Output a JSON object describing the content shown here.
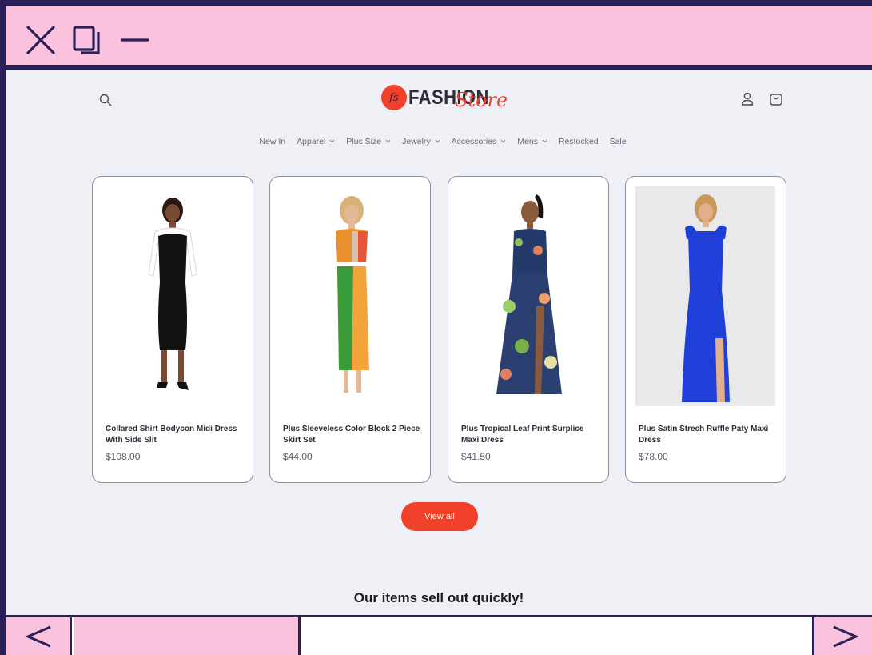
{
  "window": {
    "controls": [
      "close-icon",
      "restore-icon",
      "minimize-icon"
    ],
    "accent": "#fbc2dd",
    "frame_color": "#2a1f56"
  },
  "store": {
    "logo_mark": "fs",
    "logo_main": "FASHION",
    "logo_script": "Store",
    "brand_color": "#f0412b",
    "nav": [
      {
        "label": "New In",
        "dropdown": false
      },
      {
        "label": "Apparel",
        "dropdown": true
      },
      {
        "label": "Plus Size",
        "dropdown": true
      },
      {
        "label": "Jewelry",
        "dropdown": true
      },
      {
        "label": "Accessories",
        "dropdown": true
      },
      {
        "label": "Mens",
        "dropdown": true
      },
      {
        "label": "Restocked",
        "dropdown": false
      },
      {
        "label": "Sale",
        "dropdown": false
      }
    ]
  },
  "products": [
    {
      "title": "Collared Shirt Bodycon Midi Dress With Side Slit",
      "price": "$108.00",
      "image": "model-black-white-dress"
    },
    {
      "title": "Plus Sleeveless Color Block 2 Piece Skirt Set",
      "price": "$44.00",
      "image": "model-color-block-set"
    },
    {
      "title": "Plus Tropical Leaf Print Surplice Maxi Dress",
      "price": "$41.50",
      "image": "model-tropical-maxi"
    },
    {
      "title": "Plus Satin Strech Ruffle Paty Maxi Dress",
      "price": "$78.00",
      "image": "model-blue-satin-maxi"
    }
  ],
  "view_all_label": "View all",
  "sell_out_heading": "Our items sell out quickly!",
  "browser": {
    "back_icon": "chevron-left-icon",
    "forward_icon": "chevron-right-icon"
  }
}
